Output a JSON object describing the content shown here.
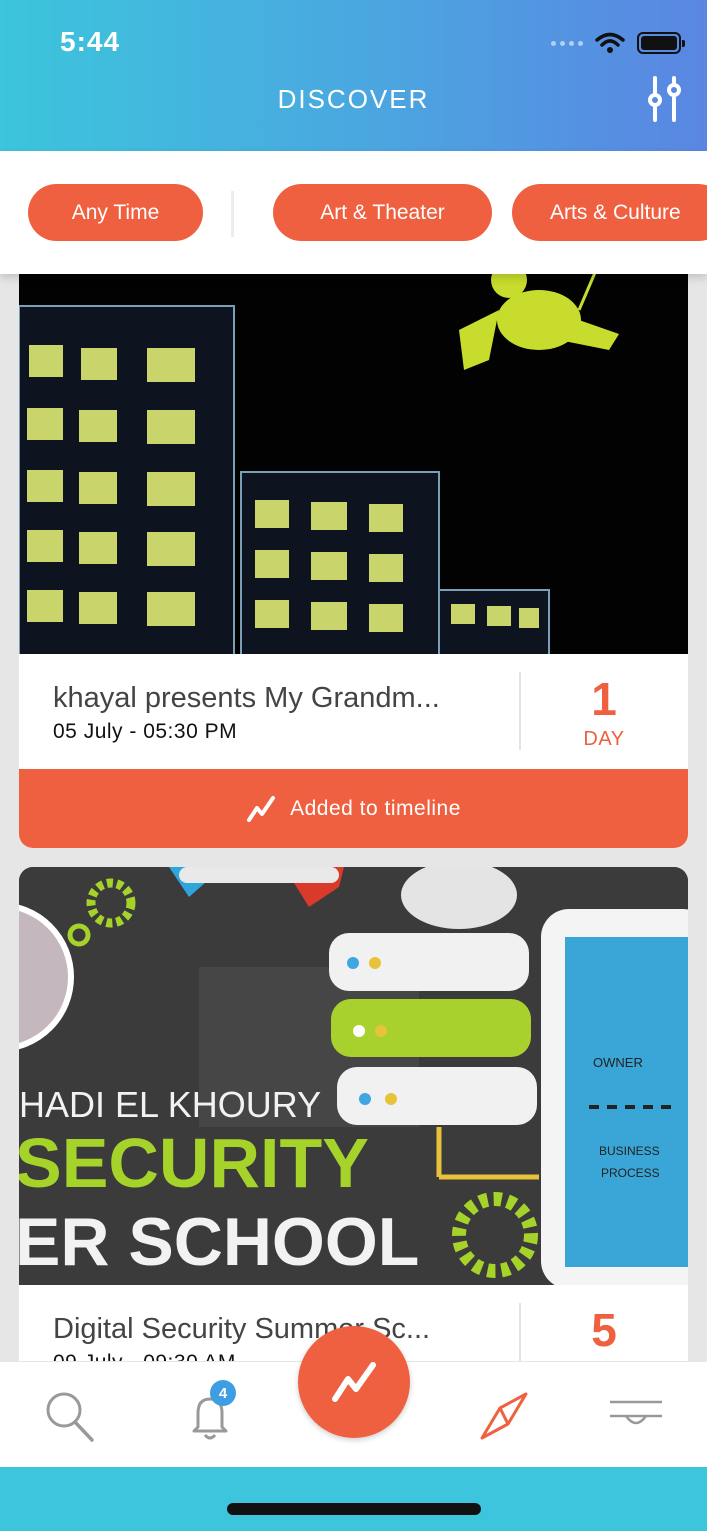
{
  "status_bar": {
    "time": "5:44"
  },
  "header": {
    "title": "DISCOVER",
    "filter_icon": "sliders-icon"
  },
  "filters": {
    "chips": [
      {
        "label": "Any Time"
      },
      {
        "label": "Art & Theater"
      },
      {
        "label": "Arts & Culture"
      }
    ]
  },
  "events": [
    {
      "title": "khayal presents My Grandm...",
      "date": "05 July - 05:30 PM",
      "count": "1",
      "count_unit": "DAY",
      "timeline_label": "Added to timeline",
      "timeline_icon": "trend-icon"
    },
    {
      "title": "Digital Security Summer Sc...",
      "date": "09 July - 09:30 AM",
      "count": "5",
      "image_text": {
        "line1": "HADI EL KHOURY",
        "line2": "SECURITY",
        "line3": "ER SCHOOL",
        "owner": "OWNER",
        "business1": "BUSINESS",
        "business2": "PROCESS"
      }
    }
  ],
  "tabbar": {
    "tabs": [
      {
        "icon": "search-icon"
      },
      {
        "icon": "bell-icon",
        "badge": "4"
      },
      {
        "icon": "trend-icon"
      },
      {
        "icon": "compass-icon"
      },
      {
        "icon": "menu-icon"
      }
    ]
  },
  "colors": {
    "accent": "#ef6040",
    "header_start": "#3cc5dc",
    "header_end": "#5a86e2",
    "badge": "#3e9ee2"
  }
}
